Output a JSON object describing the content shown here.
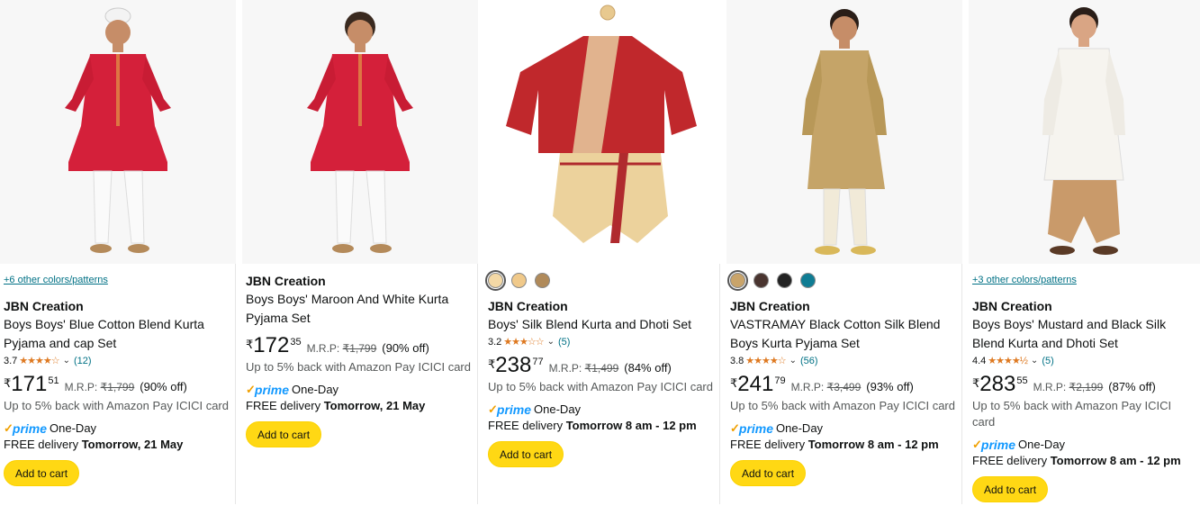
{
  "products": [
    {
      "colors_link": "+6 other colors/patterns",
      "brand": "JBN Creation",
      "title_line1": "Boys Boys' Blue Cotton Blend Kurta",
      "title_line2": "Pyjama and cap Set",
      "rating": "3.7",
      "stars": "★★★★☆",
      "review_count": "(12)",
      "currency": "₹",
      "price_whole": "171",
      "price_fraction": "51",
      "mrp_label": "M.R.P:",
      "mrp_value": "₹1,799",
      "discount": "(90% off)",
      "cashback": "Up to 5% back with Amazon Pay ICICI card",
      "prime_label": "prime",
      "prime_speed": "One-Day",
      "delivery_prefix": "FREE delivery ",
      "delivery_time": "Tomorrow, 21 May",
      "cart_label": "Add to cart",
      "image": {
        "kurta_color": "#d4203a",
        "pant_color": "#ffffff",
        "cap": true
      }
    },
    {
      "brand": "JBN Creation",
      "title_line1": "Boys Boys' Maroon And White Kurta",
      "title_line2": "Pyjama Set",
      "currency": "₹",
      "price_whole": "172",
      "price_fraction": "35",
      "mrp_label": "M.R.P:",
      "mrp_value": "₹1,799",
      "discount": "(90% off)",
      "cashback": "Up to 5% back with Amazon Pay ICICI card",
      "prime_label": "prime",
      "prime_speed": "One-Day",
      "delivery_prefix": "FREE delivery ",
      "delivery_time": "Tomorrow, 21 May",
      "cart_label": "Add to cart",
      "image": {
        "kurta_color": "#d4203a",
        "pant_color": "#ffffff",
        "cap": false
      }
    },
    {
      "swatches": [
        "#f4d9a6",
        "#f0c98a",
        "#b08a5a"
      ],
      "brand": "JBN Creation",
      "title_line1": "Boys' Silk Blend Kurta and Dhoti Set",
      "rating": "3.2",
      "stars": "★★★☆☆",
      "review_count": "(5)",
      "currency": "₹",
      "price_whole": "238",
      "price_fraction": "77",
      "mrp_label": "M.R.P:",
      "mrp_value": "₹1,499",
      "discount": "(84% off)",
      "cashback": "Up to 5% back with Amazon Pay ICICI card",
      "prime_label": "prime",
      "prime_speed": "One-Day",
      "delivery_prefix": "FREE delivery ",
      "delivery_time": "Tomorrow 8 am - 12 pm",
      "cart_label": "Add to cart",
      "image": {
        "kurta_color": "#c0282c",
        "pant_color": "#e8c98f",
        "cap": false
      }
    },
    {
      "swatches": [
        "#c9a46a",
        "#4a3530",
        "#222222",
        "#0f7c93"
      ],
      "brand": "JBN Creation",
      "title_line1": "VASTRAMAY Black Cotton Silk Blend",
      "title_line2": "Boys Kurta Pyjama Set",
      "rating": "3.8",
      "stars": "★★★★☆",
      "review_count": "(56)",
      "currency": "₹",
      "price_whole": "241",
      "price_fraction": "79",
      "mrp_label": "M.R.P:",
      "mrp_value": "₹3,499",
      "discount": "(93% off)",
      "cashback": "Up to 5% back with Amazon Pay ICICI card",
      "prime_label": "prime",
      "prime_speed": "One-Day",
      "delivery_prefix": "FREE delivery ",
      "delivery_time": "Tomorrow 8 am - 12 pm",
      "cart_label": "Add to cart",
      "image": {
        "kurta_color": "#c5a468",
        "pant_color": "#f1ead8",
        "cap": false
      }
    },
    {
      "colors_link": "+3 other colors/patterns",
      "brand": "JBN Creation",
      "title_line1": "Boys Boys' Mustard and Black Silk",
      "title_line2": "Blend Kurta and Dhoti Set",
      "rating": "4.4",
      "stars": "★★★★½",
      "review_count": "(5)",
      "currency": "₹",
      "price_whole": "283",
      "price_fraction": "55",
      "mrp_label": "M.R.P:",
      "mrp_value": "₹2,199",
      "discount": "(87% off)",
      "cashback": "Up to 5% back with Amazon Pay ICICI card",
      "prime_label": "prime",
      "prime_speed": "One-Day",
      "delivery_prefix": "FREE delivery ",
      "delivery_time": "Tomorrow 8 am - 12 pm",
      "cart_label": "Add to cart",
      "image": {
        "kurta_color": "#f6f4ef",
        "pant_color": "#c99a6a",
        "cap": false
      }
    }
  ]
}
